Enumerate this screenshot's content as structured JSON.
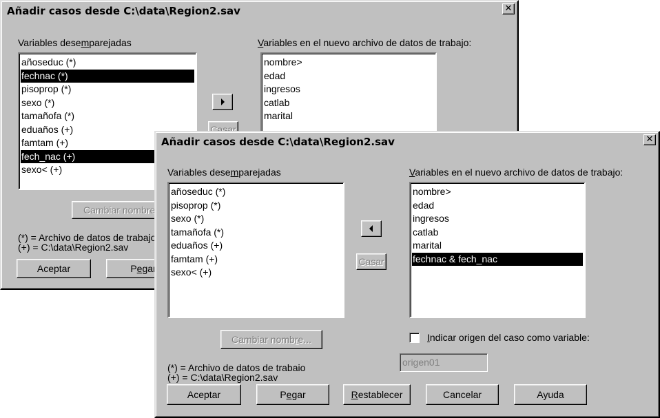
{
  "back_dialog": {
    "title": "Añadir casos desde C:\\data\\Region2.sav",
    "close_glyph": "✕",
    "unpaired_label_pre": "Variables dese",
    "unpaired_label_u": "m",
    "unpaired_label_post": "parejadas",
    "unpaired_items": [
      "añoseduc (*)",
      "fechnac (*)",
      "pisoprop (*)",
      "sexo (*)",
      "tamañofa (*)",
      "eduaños (+)",
      "famtam (+)",
      "fech_nac (+)",
      "sexo< (+)"
    ],
    "selected_unpaired": [
      "fechnac (*)",
      "fech_nac (+)"
    ],
    "new_vars_label_u": "V",
    "new_vars_label_post": "ariables en el nuevo archivo de datos de trabajo:",
    "new_vars_items": [
      "nombre>",
      "edad",
      "ingresos",
      "catlab",
      "marital"
    ],
    "match_button": "Casar",
    "rename_button": "Cambiar nombre...",
    "legend_line1": "(*) = Archivo de datos de trabajo",
    "legend_line2": "(+) = C:\\data\\Region2.sav",
    "ok_button": "Aceptar",
    "paste_button_pre": "P",
    "paste_button_u": "e",
    "paste_button_post": "gar"
  },
  "front_dialog": {
    "title": "Añadir casos desde C:\\data\\Region2.sav",
    "close_glyph": "✕",
    "unpaired_label_pre": "Variables dese",
    "unpaired_label_u": "m",
    "unpaired_label_post": "parejadas",
    "unpaired_items": [
      "añoseduc (*)",
      "pisoprop (*)",
      "sexo (*)",
      "tamañofa (*)",
      "eduaños (+)",
      "famtam (+)",
      "sexo< (+)"
    ],
    "new_vars_label_u": "V",
    "new_vars_label_post": "ariables en el nuevo archivo de datos de trabajo:",
    "new_vars_items": [
      "nombre>",
      "edad",
      "ingresos",
      "catlab",
      "marital",
      "fechnac & fech_nac"
    ],
    "selected_new_var": "fechnac & fech_nac",
    "match_button_u": "C",
    "match_button_post": "asar",
    "rename_button_pre": "Cambiar nomb",
    "rename_button_u": "r",
    "rename_button_post": "e...",
    "indicate_origin_u": "I",
    "indicate_origin_post": "ndicar origen del caso como variable:",
    "indicate_origin_checked": false,
    "origin_var_value": "origen01",
    "legend_line1": "(*) = Archivo de datos de trabaio",
    "legend_line2": "(+) = C:\\data\\Region2.sav",
    "ok_button": "Aceptar",
    "paste_button_pre": "P",
    "paste_button_u": "e",
    "paste_button_post": "gar",
    "reset_button_u": "R",
    "reset_button_post": "establecer",
    "cancel_button": "Cancelar",
    "help_button": "Ayuda"
  }
}
